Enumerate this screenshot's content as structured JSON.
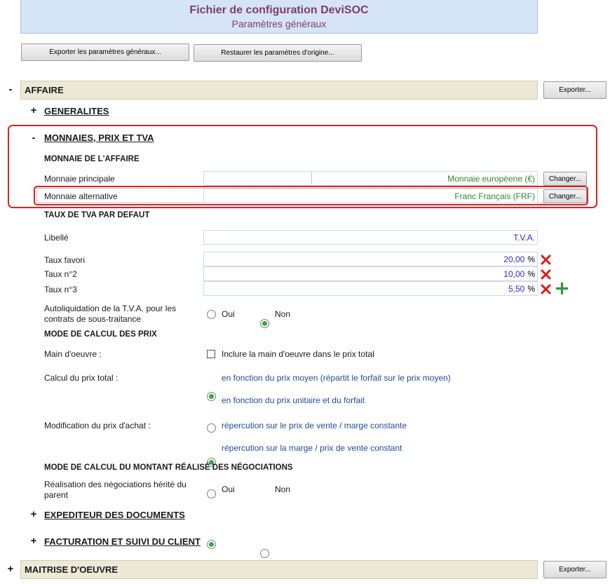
{
  "header": {
    "title": "Fichier de configuration DeviSOC",
    "subtitle": "Paramètres généraux"
  },
  "toolbar": {
    "export_label": "Exporter les paramètres généraux...",
    "restore_label": "Restaurer les paramètres d'origine..."
  },
  "affaire": {
    "toggle": "-",
    "title": "AFFAIRE",
    "export_label": "Exporter...",
    "generalites": {
      "toggle": "+",
      "title": "GENERALITES"
    },
    "monnaies": {
      "toggle": "-",
      "title": "MONNAIES, PRIX ET TVA",
      "monnaie_group": "MONNAIE DE L'AFFAIRE",
      "principale": {
        "label": "Monnaie principale",
        "value": "Monnaie européene (€)",
        "button": "Changer..."
      },
      "alternative": {
        "label": "Monnaie alternative",
        "value": "Franc Français (FRF)",
        "button": "Changer..."
      },
      "tva_group": "TAUX DE TVA PAR DEFAUT",
      "libelle": {
        "label": "Libellé",
        "value": "T.V.A."
      },
      "taux": [
        {
          "label": "Taux favori",
          "value": "20,00",
          "unit": "%"
        },
        {
          "label": "Taux n°2",
          "value": "10,00",
          "unit": "%"
        },
        {
          "label": "Taux n°3",
          "value": "5,50",
          "unit": "%"
        }
      ],
      "autoliq": {
        "label": "Autoliquidation de la T.V.A. pour les contrats de sous-traitance",
        "oui": "Oui",
        "non": "Non",
        "selected": "Non"
      },
      "calcul_group": "MODE DE CALCUL DES PRIX",
      "main_oeuvre": {
        "label": "Main d'oeuvre :",
        "checkbox": "Inclure la main d'oeuvre dans le prix total",
        "checked": false
      },
      "calcul_total": {
        "label": "Calcul du prix total :",
        "opt1": "en fonction du prix moyen (répartit le forfait sur le prix moyen)",
        "opt2": "en fonction du prix unitaire et du forfait",
        "selected": 1
      },
      "modif_achat": {
        "label": "Modification du prix d'achat :",
        "opt1": "répercution sur le prix de vente / marge constante",
        "opt2": "répercution sur la marge / prix de vente constant",
        "selected": 1
      },
      "nego_group": "MODE DE CALCUL DU MONTANT RÉALISÉ DES NÉGOCIATIONS",
      "nego": {
        "label": "Réalisation des négociations hérité du parent",
        "oui": "Oui",
        "non": "Non",
        "selected": "Oui"
      }
    },
    "expediteur": {
      "toggle": "+",
      "title": "EXPEDITEUR DES DOCUMENTS"
    },
    "facturation": {
      "toggle": "+",
      "title": "FACTURATION ET SUIVI DU CLIENT"
    }
  },
  "maitrise": {
    "toggle": "+",
    "title": "MAITRISE D'OEUVRE",
    "export_label": "Exporter..."
  },
  "colors": {
    "highlight": "#e02020",
    "section_bg": "#ede9d6",
    "header_bg": "#d6e4f8",
    "value_green": "#2e8a2e",
    "value_blue": "#2b2bd0",
    "radio_on": "#35a84a"
  }
}
